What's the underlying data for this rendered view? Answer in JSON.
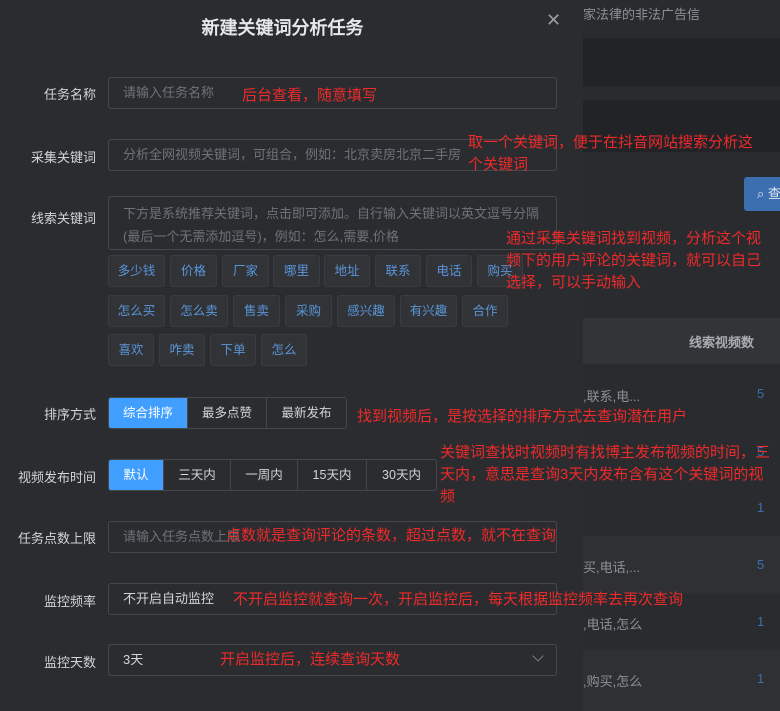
{
  "background": {
    "top_text": "家法律的非法广告信",
    "search_button_label": "查",
    "table_header": "线索视频数",
    "rows": [
      {
        "text": ",联系,电...",
        "num": "5"
      },
      {
        "text": "",
        "num": "5"
      },
      {
        "text": "",
        "num": "1"
      },
      {
        "text": "买,电话,...",
        "num": "5"
      },
      {
        "text": ",电话,怎么",
        "num": "1"
      },
      {
        "text": ",购买,怎么",
        "num": "1"
      }
    ]
  },
  "modal": {
    "title": "新建关键词分析任务",
    "close_icon": "close-icon",
    "task_name": {
      "label": "任务名称",
      "placeholder": "请输入任务名称"
    },
    "collect_keyword": {
      "label": "采集关键词",
      "placeholder": "分析全网视频关键词，可组合，例如：北京卖房北京二手房"
    },
    "clue_keyword": {
      "label": "线索关键词",
      "placeholder": "下方是系统推荐关键词，点击即可添加。自行输入关键词以英文逗号分隔(最后一个无需添加逗号)，例如：怎么,需要,价格",
      "tags_row1": [
        "多少钱",
        "价格",
        "厂家",
        "哪里",
        "地址",
        "联系",
        "电话",
        "购买"
      ],
      "tags_row2": [
        "怎么买",
        "怎么卖",
        "售卖",
        "采购",
        "感兴趣",
        "有兴趣",
        "合作"
      ],
      "tags_row3": [
        "喜欢",
        "咋卖",
        "下单",
        "怎么"
      ]
    },
    "sort": {
      "label": "排序方式",
      "options": [
        "综合排序",
        "最多点赞",
        "最新发布"
      ],
      "selected": "综合排序"
    },
    "publish_time": {
      "label": "视频发布时间",
      "options": [
        "默认",
        "三天内",
        "一周内",
        "15天内",
        "30天内"
      ],
      "selected": "默认"
    },
    "points_limit": {
      "label": "任务点数上限",
      "placeholder": "请输入任务点数上限"
    },
    "monitor_freq": {
      "label": "监控频率",
      "value": "不开启自动监控"
    },
    "monitor_days": {
      "label": "监控天数",
      "value": "3天"
    }
  },
  "annotations": {
    "task_name": "后台查看，随意填写",
    "collect_keyword": "取一个关键词，便于在抖音网站搜索分析这个关键词",
    "clue_keyword": "通过采集关键词找到视频，分析这个视频下的用户评论的关键词，就可以自己选择，可以手动输入",
    "sort": "找到视频后，是按选择的排序方式去查询潜在用户",
    "publish_time": "关键词查找时视频时有找博主发布视频的时间，三天内，意思是查询3天内发布含有这个关键词的视频",
    "points_limit": "点数就是查询评论的条数，超过点数，就不在查询",
    "monitor_freq": "不开启监控就查询一次，开启监控后，每天根据监控频率去再次查询",
    "monitor_days": "开启监控后，连续查询天数"
  },
  "colors": {
    "accent": "#409eff",
    "annotation": "#ee2a2a",
    "tag_text": "#5a95d8"
  }
}
